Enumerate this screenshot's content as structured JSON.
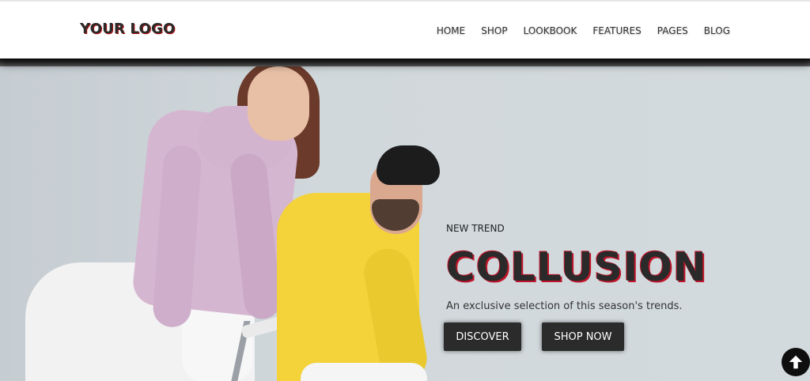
{
  "header": {
    "logo_text": "YOUR LOGO",
    "nav": [
      "HOME",
      "SHOP",
      "LOOKBOOK",
      "FEATURES",
      "PAGES",
      "BLOG"
    ]
  },
  "hero": {
    "eyebrow": "NEW TREND",
    "title": "COLLUSION",
    "subtitle": "An exclusive selection of this season's trends.",
    "buttons": {
      "discover": "DISCOVER",
      "shop_now": "SHOP NOW"
    }
  },
  "colors": {
    "accent": "#c0152a",
    "button_bg": "#2b2b2b",
    "hero_bg": "#d1d8dc"
  },
  "icons": {
    "scroll_top": "arrow-up-icon"
  }
}
